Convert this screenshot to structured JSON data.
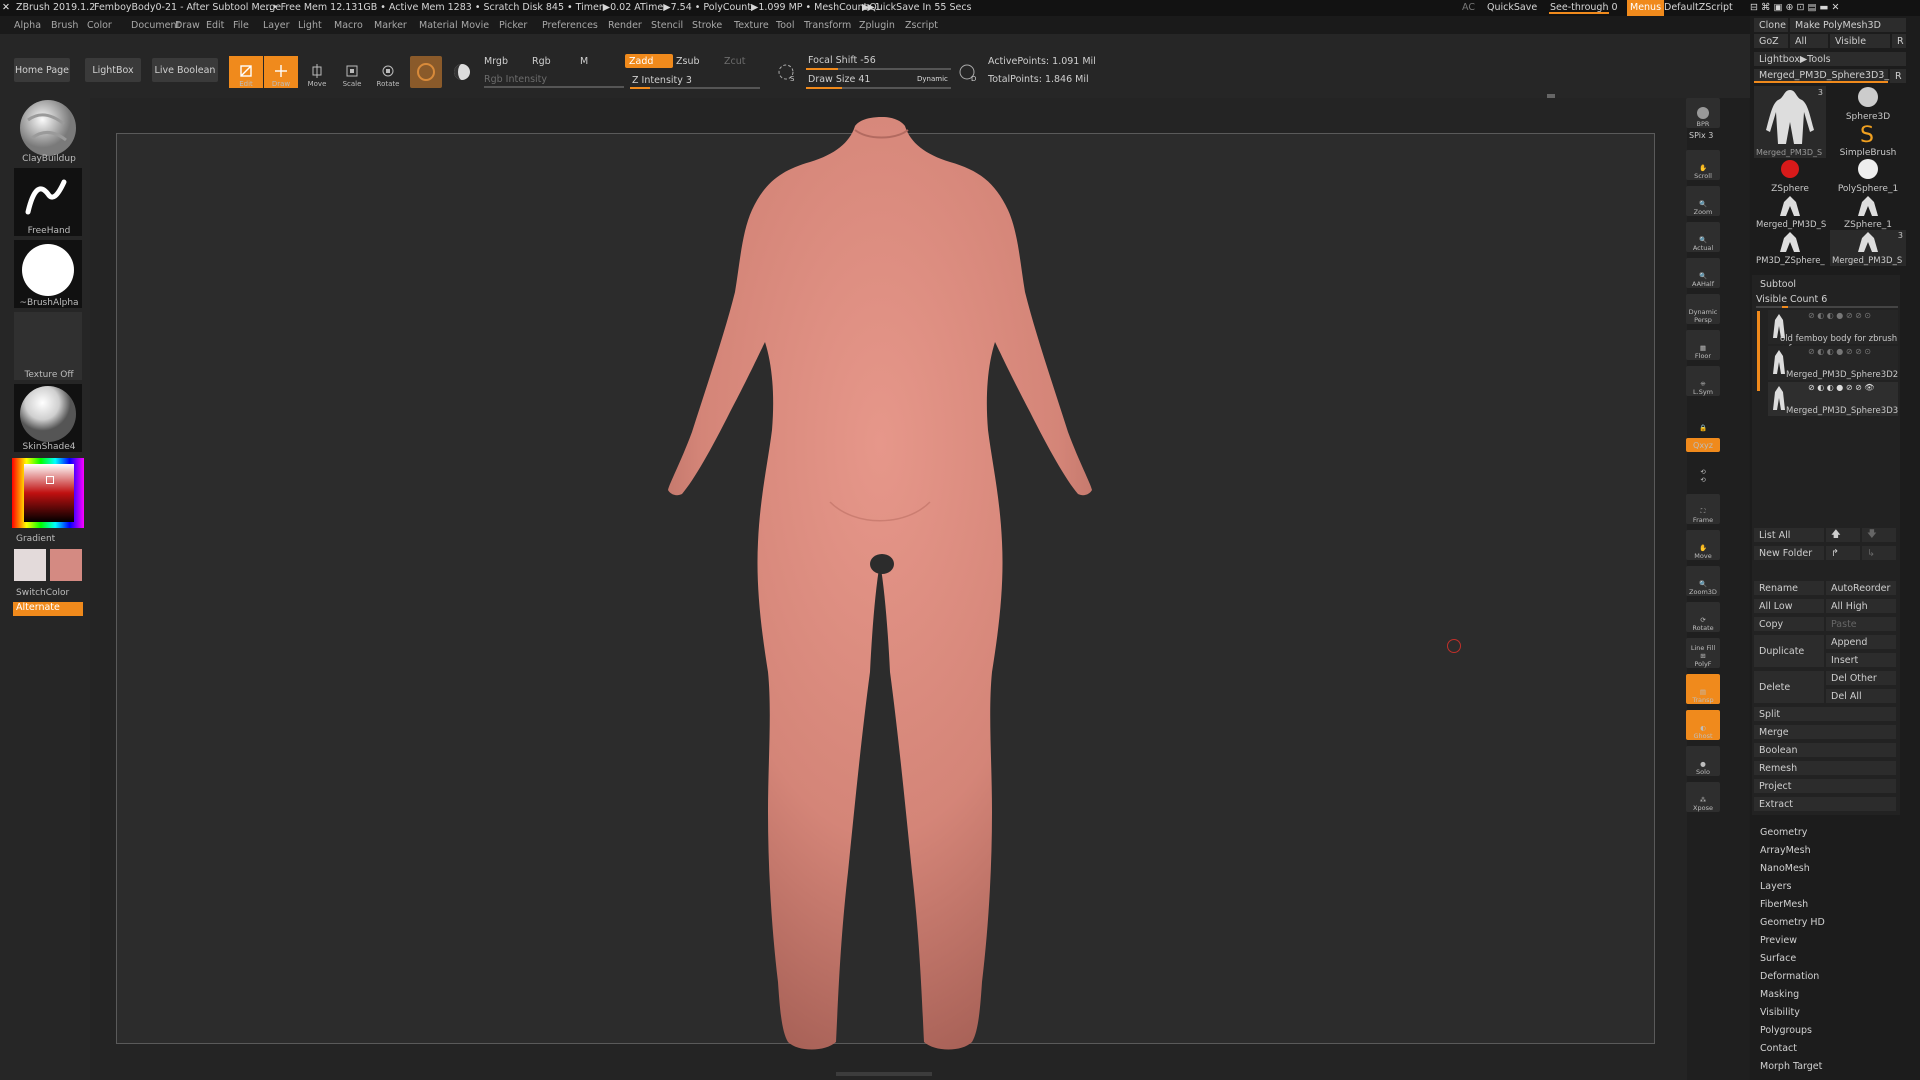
{
  "title_bar": {
    "app": "ZBrush 2019.1.2",
    "document": "FemboyBody0-21 - After Subtool Merge",
    "stats": "..• Free Mem 12.131GB • Active Mem 1283 • Scratch Disk 845 • Timer▶0.02 ATime▶7.54 • PolyCount▶1.099 MP • MeshCount▶1",
    "quicksave_info": "▶QuickSave In 55 Secs",
    "ac": "AC",
    "quicksave": "QuickSave",
    "see_through": "See-through 0",
    "menus": "Menus",
    "script": "DefaultZScript"
  },
  "menu_items": [
    "Alpha",
    "Brush",
    "Color",
    "Document",
    "Draw",
    "Edit",
    "File",
    "Layer",
    "Light",
    "Macro",
    "Marker",
    "Material",
    "Movie",
    "Picker",
    "Preferences",
    "Render",
    "Stencil",
    "Stroke",
    "Texture",
    "Tool",
    "Transform",
    "Zplugin",
    "Zscript"
  ],
  "toolbar": {
    "home_page": "Home Page",
    "lightbox": "LightBox",
    "live_boolean": "Live Boolean",
    "edit": "Edit",
    "draw": "Draw",
    "move": "Move",
    "scale": "Scale",
    "rotate": "Rotate",
    "mrgb": "Mrgb",
    "rgb": "Rgb",
    "m": "M",
    "rgb_intensity": "Rgb Intensity",
    "zadd": "Zadd",
    "zsub": "Zsub",
    "zcut": "Zcut",
    "z_intensity": "Z Intensity 3",
    "z_intensity_value": 0.15,
    "focal_shift": "Focal Shift -56",
    "focal_shift_value": 0.22,
    "draw_size": "Draw Size 41",
    "draw_size_value": 0.25,
    "dynamic": "Dynamic",
    "active_points": "ActivePoints: 1.091 Mil",
    "total_points": "TotalPoints: 1.846 Mil"
  },
  "left_shelf": {
    "brush": "ClayBuildup",
    "stroke": "FreeHand",
    "alpha": "~BrushAlpha",
    "texture": "Texture Off",
    "material": "SkinShade4",
    "gradient": "Gradient",
    "switch_color": "SwitchColor",
    "alternate": "Alternate"
  },
  "right_shelf": {
    "bpr": "BPR",
    "spix": "SPix 3",
    "scroll": "Scroll",
    "zoom": "Zoom",
    "actual": "Actual",
    "aahalf": "AAHalf",
    "dynamic": "Dynamic",
    "persp": "Persp",
    "floor": "Floor",
    "lsym": "L.Sym",
    "xyz": "Qxyz",
    "frame": "Frame",
    "move": "Move",
    "zoom3d": "Zoom3D",
    "rotate": "Rotate",
    "line_fill": "Line Fill",
    "polyf": "PolyF",
    "transp": "Transp",
    "ghost": "Ghost",
    "solo": "Solo",
    "xpose": "Xpose"
  },
  "tool_panel": {
    "clone": "Clone",
    "make_polymesh": "Make PolyMesh3D",
    "goz": "GoZ",
    "all": "All",
    "visible": "Visible",
    "r": "R",
    "lightbox_tools": "Lightbox▶Tools",
    "current_tool": "Merged_PM3D_Sphere3D3_",
    "r2": "R",
    "thumbs": [
      {
        "label": "Merged_PM3D_S",
        "count": "3"
      },
      {
        "label": "Sphere3D"
      },
      {
        "label": "SimpleBrush"
      },
      {
        "label": "ZSphere"
      },
      {
        "label": "PolySphere_1"
      },
      {
        "label": "Merged_PM3D_S"
      },
      {
        "label": "ZSphere_1"
      },
      {
        "label": "PM3D_ZSphere_"
      },
      {
        "label": "Merged_PM3D_S",
        "count": "3"
      }
    ]
  },
  "subtool": {
    "header": "Subtool",
    "visible_count": "Visible Count 6",
    "items": [
      "old femboy body for zbrush ref",
      "Merged_PM3D_Sphere3D2",
      "Merged_PM3D_Sphere3D3"
    ],
    "list_all": "List All",
    "new_folder": "New Folder",
    "rename": "Rename",
    "auto_reorder": "AutoReorder",
    "all_low": "All Low",
    "all_high": "All High",
    "copy": "Copy",
    "paste": "Paste",
    "duplicate": "Duplicate",
    "append": "Append",
    "insert": "Insert",
    "delete": "Delete",
    "del_other": "Del Other",
    "del_all": "Del All",
    "split": "Split",
    "merge": "Merge",
    "boolean": "Boolean",
    "remesh": "Remesh",
    "project": "Project",
    "extract": "Extract"
  },
  "tool_sections": [
    "Geometry",
    "ArrayMesh",
    "NanoMesh",
    "Layers",
    "FiberMesh",
    "Geometry HD",
    "Preview",
    "Surface",
    "Deformation",
    "Masking",
    "Visibility",
    "Polygroups",
    "Contact",
    "Morph Target"
  ],
  "colors": {
    "accent": "#f08a1c",
    "skin": "#d48578",
    "main_color": "#e3dada",
    "secondary_color": "#d48a82"
  }
}
